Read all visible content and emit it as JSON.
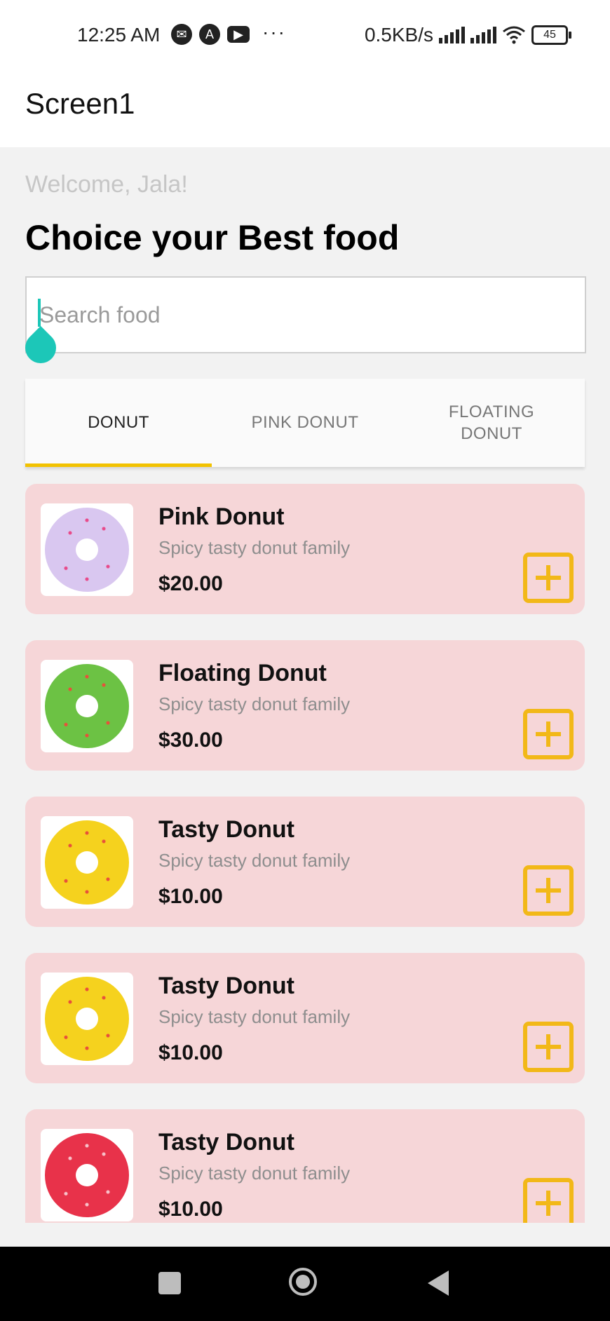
{
  "status_bar": {
    "time": "12:25 AM",
    "dots": "···",
    "network_speed": "0.5KB/s",
    "battery": "45",
    "icons": [
      "messenger-icon",
      "app-a-icon",
      "youtube-icon",
      "signal-icon",
      "signal-icon",
      "wifi-icon",
      "battery-icon"
    ]
  },
  "header": {
    "title": "Screen1"
  },
  "main": {
    "welcome": "Welcome, Jala!",
    "headline": "Choice your Best food",
    "search": {
      "placeholder": "Search food",
      "value": ""
    },
    "tabs": [
      {
        "label": "DONUT",
        "active": true
      },
      {
        "label": "PINK DONUT",
        "active": false
      },
      {
        "label": "FLOATING\nDONUT",
        "active": false
      }
    ],
    "items": [
      {
        "name": "Pink Donut",
        "desc": "Spicy tasty donut family",
        "price": "$20.00",
        "donut_color": "#d9c7f0",
        "sprinkle": "#e84a8a"
      },
      {
        "name": "Floating Donut",
        "desc": "Spicy tasty donut family",
        "price": "$30.00",
        "donut_color": "#6cc244",
        "sprinkle": "#e8503a"
      },
      {
        "name": "Tasty Donut",
        "desc": "Spicy tasty donut family",
        "price": "$10.00",
        "donut_color": "#f5d21e",
        "sprinkle": "#e8503a"
      },
      {
        "name": "Tasty Donut",
        "desc": "Spicy tasty donut family",
        "price": "$10.00",
        "donut_color": "#f5d21e",
        "sprinkle": "#e8503a"
      },
      {
        "name": "Tasty Donut",
        "desc": "Spicy tasty donut family",
        "price": "$10.00",
        "donut_color": "#e8324a",
        "sprinkle": "#f7c1c9"
      }
    ]
  },
  "colors": {
    "accent": "#f2c200",
    "add_button": "#f2b818",
    "card_background": "#f6d6d8",
    "cursor": "#1cc7b8"
  }
}
